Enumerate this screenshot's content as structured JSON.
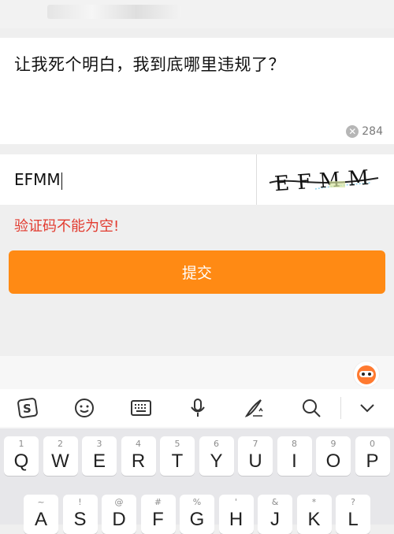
{
  "text_area": {
    "content": "让我死个明白，我到底哪里违规了？",
    "remaining_count": "284"
  },
  "captcha": {
    "input_value": "EFMM",
    "image_text": "EFMM"
  },
  "error_message": "验证码不能为空!",
  "submit_label": "提交",
  "keyboard": {
    "row1": [
      {
        "hint": "1",
        "key": "Q"
      },
      {
        "hint": "2",
        "key": "W"
      },
      {
        "hint": "3",
        "key": "E"
      },
      {
        "hint": "4",
        "key": "R"
      },
      {
        "hint": "5",
        "key": "T"
      },
      {
        "hint": "6",
        "key": "Y"
      },
      {
        "hint": "7",
        "key": "U"
      },
      {
        "hint": "8",
        "key": "I"
      },
      {
        "hint": "9",
        "key": "O"
      },
      {
        "hint": "0",
        "key": "P"
      }
    ],
    "row2": [
      {
        "hint": "~",
        "key": "A"
      },
      {
        "hint": "!",
        "key": "S"
      },
      {
        "hint": "@",
        "key": "D"
      },
      {
        "hint": "#",
        "key": "F"
      },
      {
        "hint": "%",
        "key": "G"
      },
      {
        "hint": "'",
        "key": "H"
      },
      {
        "hint": "&",
        "key": "J"
      },
      {
        "hint": "*",
        "key": "K"
      },
      {
        "hint": "?",
        "key": "L"
      }
    ]
  },
  "toolbar_icons": [
    "sogou-logo-icon",
    "emoji-icon",
    "keyboard-icon",
    "microphone-icon",
    "handwriting-icon",
    "search-icon",
    "collapse-keyboard-icon"
  ],
  "colors": {
    "accent": "#ff8a14",
    "error": "#e23a2e"
  }
}
